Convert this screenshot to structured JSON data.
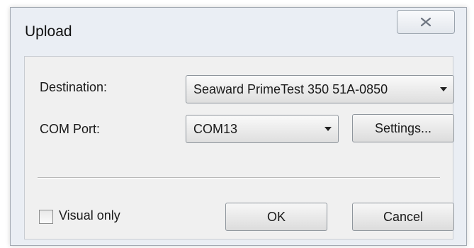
{
  "window": {
    "title": "Upload",
    "close_icon": "close-icon"
  },
  "form": {
    "destination_label": "Destination:",
    "destination_value": "Seaward PrimeTest 350 51A-0850",
    "com_port_label": "COM Port:",
    "com_port_value": "COM13",
    "settings_label": "Settings..."
  },
  "footer": {
    "visual_only_label": "Visual only",
    "visual_only_checked": false,
    "ok_label": "OK",
    "cancel_label": "Cancel"
  }
}
